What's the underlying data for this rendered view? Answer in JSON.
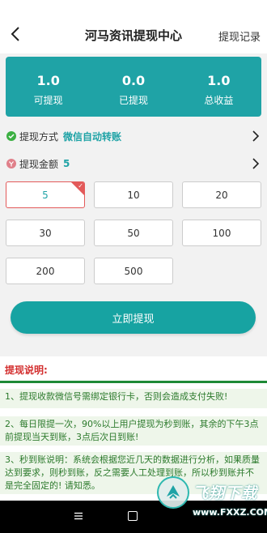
{
  "header": {
    "title": "河马资讯提现中心",
    "records_label": "提现记录"
  },
  "summary": [
    {
      "value": "1.0",
      "label": "可提现"
    },
    {
      "value": "0.0",
      "label": "已提现"
    },
    {
      "value": "1.0",
      "label": "总收益"
    }
  ],
  "method": {
    "label": "提现方式",
    "value": "微信自动转账"
  },
  "amount": {
    "label": "提现金额",
    "value": "5"
  },
  "amount_options": [
    "5",
    "10",
    "20",
    "30",
    "50",
    "100",
    "200",
    "500"
  ],
  "selected_amount": "5",
  "submit_label": "立即提现",
  "notice": {
    "title": "提现说明:",
    "items": [
      "1、提现收款微信号需绑定银行卡，否则会造成支付失败!",
      "2、每日限提一次，90%以上用户提现为秒到账，其余的下午3点前提现当天到账，3点后次日到账!",
      "3、秒到账说明：系统会根据您近几天的数据进行分析，如果质量达到要求，则秒到账，反之需要人工处理到账，所以秒到账并不是完全固定的! 请知悉。"
    ]
  },
  "watermark": {
    "text": "飞翔下载",
    "url": "www.FXXZ.COM"
  },
  "colors": {
    "accent": "#1fa3a6",
    "notice_title": "#d32f2f",
    "notice_text": "#2c7a2c",
    "selected_border": "#e35a5a"
  }
}
